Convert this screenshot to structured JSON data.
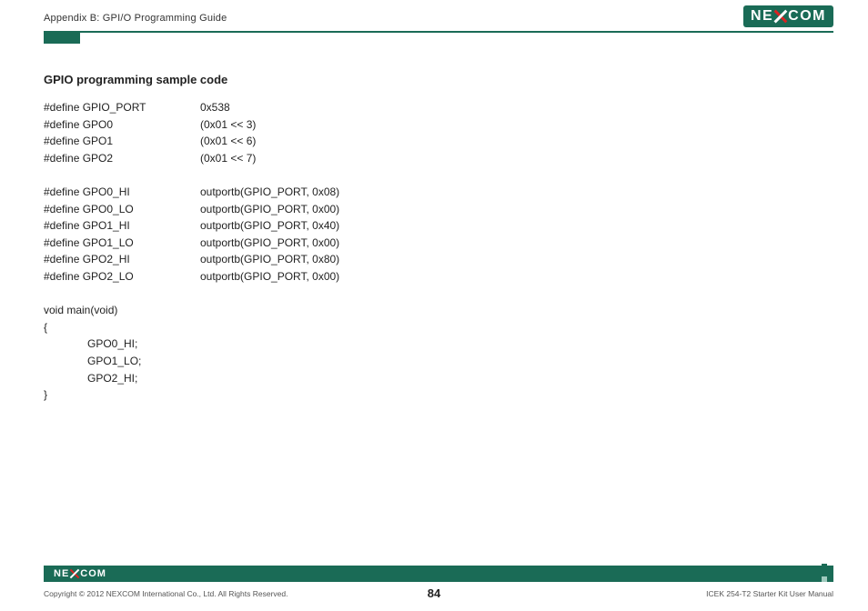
{
  "header": {
    "appendix": "Appendix B: GPI/O Programming Guide",
    "logo_left": "NE",
    "logo_right": "COM"
  },
  "section_title": "GPIO programming sample code",
  "defs1": [
    {
      "a": "#define GPIO_PORT",
      "b": "0x538"
    },
    {
      "a": "#define GPO0",
      "b": "(0x01 << 3)"
    },
    {
      "a": "#define GPO1",
      "b": "(0x01 << 6)"
    },
    {
      "a": "#define GPO2",
      "b": "(0x01 << 7)"
    }
  ],
  "defs2": [
    {
      "a": "#define GPO0_HI",
      "b": "outportb(GPIO_PORT, 0x08)"
    },
    {
      "a": "#define GPO0_LO",
      "b": "outportb(GPIO_PORT, 0x00)"
    },
    {
      "a": "#define GPO1_HI",
      "b": "outportb(GPIO_PORT, 0x40)"
    },
    {
      "a": "#define GPO1_LO",
      "b": "outportb(GPIO_PORT, 0x00)"
    },
    {
      "a": "#define GPO2_HI",
      "b": "outportb(GPIO_PORT, 0x80)"
    },
    {
      "a": "#define GPO2_LO",
      "b": "outportb(GPIO_PORT, 0x00)"
    }
  ],
  "main_sig": "void main(void)",
  "brace_open": "{",
  "main_body": [
    "GPO0_HI;",
    "GPO1_LO;",
    "GPO2_HI;"
  ],
  "brace_close": "}",
  "footer": {
    "copyright": "Copyright © 2012 NEXCOM International Co., Ltd. All Rights Reserved.",
    "page": "84",
    "manual": "ICEK 254-T2 Starter Kit User Manual"
  }
}
